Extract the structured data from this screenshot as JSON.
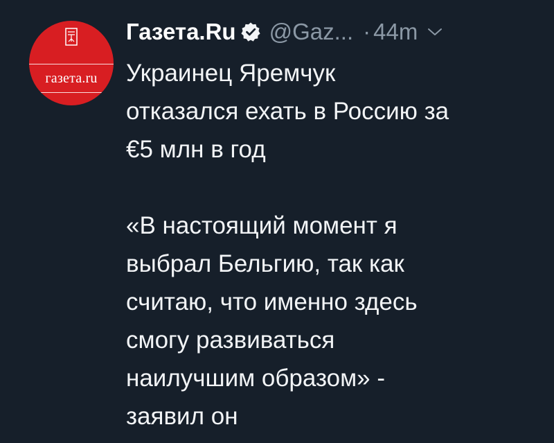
{
  "tweet": {
    "author": {
      "name": "Газета.Ru",
      "handle": "@Gaz...",
      "avatar_text": "газета.ru",
      "verified": true,
      "avatar_color": "#d81e22"
    },
    "separator": "·",
    "time": "44m",
    "paragraphs": [
      [
        "Украинец Яремчук",
        "отказался ехать в Россию за",
        "€5 млн в год"
      ],
      [
        "«В настоящий момент я",
        "выбрал Бельгию, так как",
        "считаю, что именно здесь",
        "смогу развиваться",
        "наилучшим образом» -",
        "заявил он"
      ]
    ]
  },
  "icons": {
    "verified": "verified-badge-icon",
    "chevron": "chevron-down-icon",
    "logo": "newspaper-logo-icon"
  },
  "colors": {
    "background": "#161f2a",
    "text": "#f2f4f6",
    "muted": "#8b98a5"
  }
}
